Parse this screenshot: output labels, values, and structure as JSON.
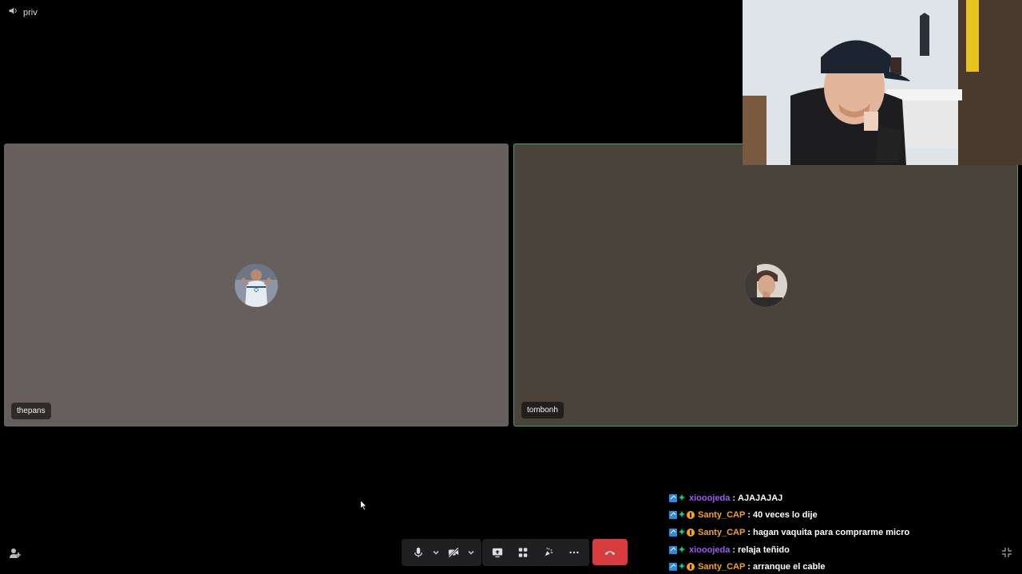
{
  "header": {
    "channel_name": "priv",
    "channel_icon": "speaker-icon"
  },
  "tiles": [
    {
      "username": "thepans",
      "background": "#675f5e",
      "speaking": false
    },
    {
      "username": "tombonh",
      "background": "#49433c",
      "speaking": true
    }
  ],
  "colors": {
    "speaking_border": "#3ba55c",
    "hangup": "#d83c3e",
    "chat_purple": "#9b5cf6",
    "chat_gold": "#f2a41c"
  },
  "chat": [
    {
      "user": "xiooojeda",
      "separator": ":",
      "message": "AJAJAJAJ",
      "color": "#9b5cf6",
      "badges": [
        "prime",
        "sparkle"
      ]
    },
    {
      "user": "Santy_CAP",
      "separator": ":",
      "message": "40 veces lo dije",
      "color": "#f2a41c",
      "badges": [
        "prime",
        "sparkle",
        "coin"
      ]
    },
    {
      "user": "Santy_CAP",
      "separator": ":",
      "message": "hagan vaquita para comprarme micro",
      "color": "#f2a41c",
      "badges": [
        "prime",
        "sparkle",
        "coin"
      ]
    },
    {
      "user": "xiooojeda",
      "separator": ":",
      "message": "relaja teñido",
      "color": "#9b5cf6",
      "badges": [
        "prime",
        "sparkle"
      ]
    },
    {
      "user": "Santy_CAP",
      "separator": ":",
      "message": "arranque el cable",
      "color": "#f2a41c",
      "badges": [
        "prime",
        "sparkle",
        "coin"
      ]
    }
  ],
  "controls": {
    "icons": [
      "microphone-icon",
      "camera-off-icon",
      "screen-share-icon",
      "activities-icon",
      "soundboard-icon",
      "more-icon",
      "hangup-icon"
    ]
  }
}
